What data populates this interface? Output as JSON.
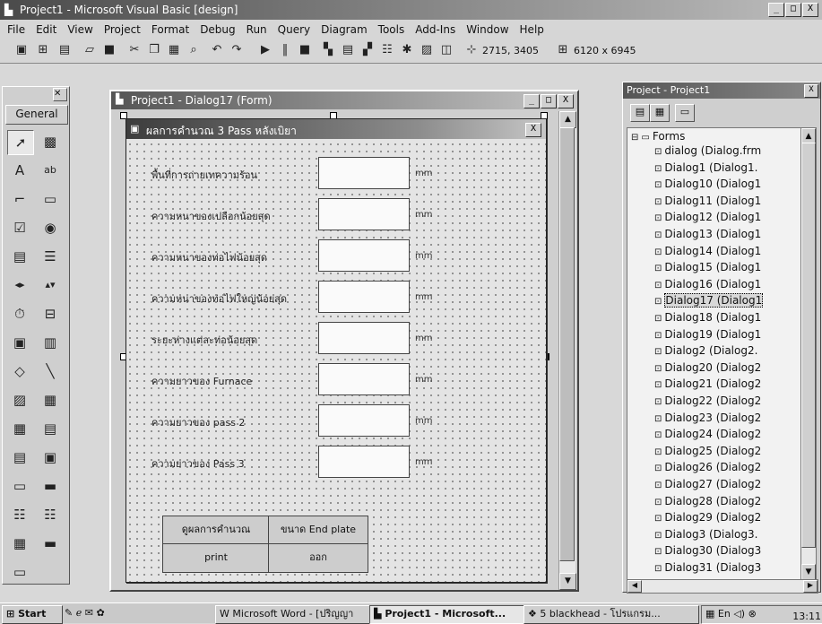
{
  "window": {
    "title": "Project1 - Microsoft Visual Basic [design]",
    "controls": [
      "_",
      "□",
      "X"
    ]
  },
  "menu": [
    "File",
    "Edit",
    "View",
    "Project",
    "Format",
    "Debug",
    "Run",
    "Query",
    "Diagram",
    "Tools",
    "Add-Ins",
    "Window",
    "Help"
  ],
  "toolbar": {
    "position": "2715, 3405",
    "size": "6120 x 6945"
  },
  "toolbox": {
    "tab_label": "General",
    "tools": [
      "pointer-icon",
      "picturebox-icon",
      "label-icon",
      "textbox-icon",
      "frame-icon",
      "commandbutton-icon",
      "checkbox-icon",
      "optionbutton-icon",
      "combobox-icon",
      "listbox-icon",
      "hscrollbar-icon",
      "vscrollbar-icon",
      "timer-icon",
      "drivelistbox-icon",
      "dirlistbox-icon",
      "filelistbox-icon",
      "shape-icon",
      "line-icon",
      "image-icon",
      "data-icon",
      "grid-icon",
      "ole-icon",
      "dbcombo-icon",
      "dblist-icon",
      "tabstrip-icon",
      "toolbar-icon",
      "treeview-icon",
      "listview-icon",
      "imagelist-icon",
      "slider-icon",
      "statusbar-icon"
    ]
  },
  "designer": {
    "title": "Project1 - Dialog17 (Form)"
  },
  "form": {
    "title": "ผลการคำนวณ 3 Pass หลังเบิยา",
    "rows": [
      {
        "label": "พื้นที่การถ่ายเทความร้อน",
        "unit": "mm"
      },
      {
        "label": "ความหนาของเปลือกน้อยสุด",
        "unit": "mm"
      },
      {
        "label": "ความหนาของท่อไฟน้อยสุด",
        "unit": "mm"
      },
      {
        "label": "ความหนาของท่อไฟใหญ่น้อยสุด",
        "unit": "mm"
      },
      {
        "label": "ระยะห่างแต่ละท่อน้อยสุด",
        "unit": "mm"
      },
      {
        "label": "ความยาวของ Furnace",
        "unit": "mm"
      },
      {
        "label": "ความยาวของ pass 2",
        "unit": "mm"
      },
      {
        "label": "ความยาวของ Pass 3",
        "unit": "mm"
      }
    ],
    "buttons": {
      "result": "ดูผลการคำนวณ",
      "endplate": "ขนาด End plate",
      "print": "print",
      "exit": "ออก"
    }
  },
  "project": {
    "title": "Project - Project1",
    "root": "Forms",
    "items": [
      "dialog (Dialog.frm",
      "Dialog1 (Dialog1.",
      "Dialog10 (Dialog1",
      "Dialog11 (Dialog1",
      "Dialog12 (Dialog1",
      "Dialog13 (Dialog1",
      "Dialog14 (Dialog1",
      "Dialog15 (Dialog1",
      "Dialog16 (Dialog1",
      "Dialog17 (Dialog1",
      "Dialog18 (Dialog1",
      "Dialog19 (Dialog1",
      "Dialog2 (Dialog2.",
      "Dialog20 (Dialog2",
      "Dialog21 (Dialog2",
      "Dialog22 (Dialog2",
      "Dialog23 (Dialog2",
      "Dialog24 (Dialog2",
      "Dialog25 (Dialog2",
      "Dialog26 (Dialog2",
      "Dialog27 (Dialog2",
      "Dialog28 (Dialog2",
      "Dialog29 (Dialog2",
      "Dialog3 (Dialog3.",
      "Dialog30 (Dialog3",
      "Dialog31 (Dialog3"
    ],
    "selected_index": 9
  },
  "taskbar": {
    "start": "Start",
    "tasks": [
      "Microsoft Word - [ปริญญา",
      "Project1 - Microsoft...",
      "5 blackhead - โปรแกรม..."
    ],
    "clock": "13:11"
  }
}
